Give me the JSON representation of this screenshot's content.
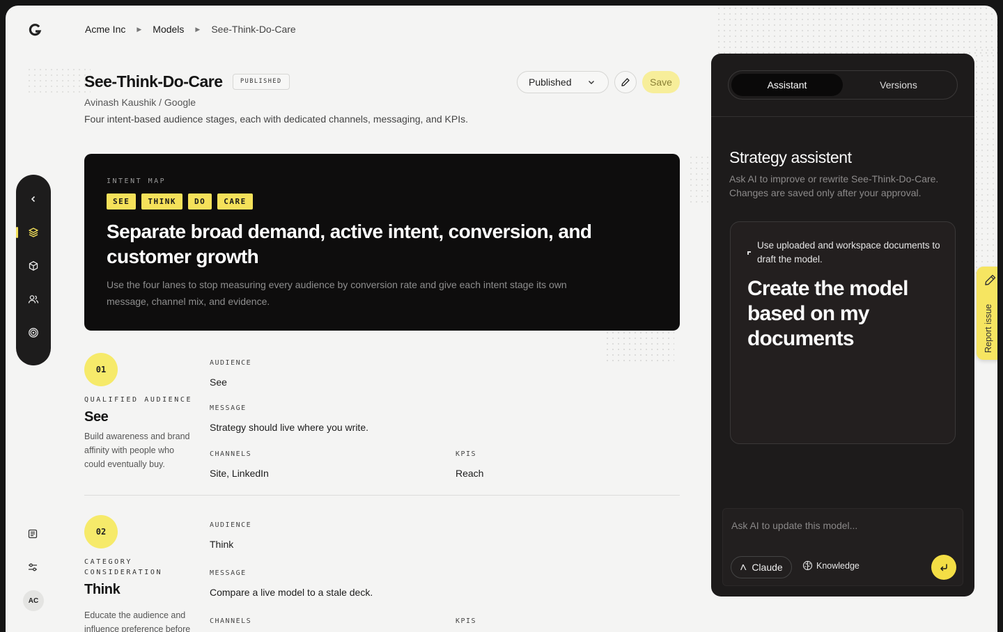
{
  "breadcrumbs": [
    "Acme Inc",
    "Models",
    "See-Think-Do-Care"
  ],
  "header": {
    "title": "See-Think-Do-Care",
    "badge": "PUBLISHED",
    "author": "Avinash Kaushik / Google",
    "description": "Four intent-based audience stages, each with dedicated channels, messaging, and KPIs.",
    "status_value": "Published",
    "save_label": "Save"
  },
  "intent_map": {
    "eyebrow": "INTENT MAP",
    "tags": [
      "SEE",
      "THINK",
      "DO",
      "CARE"
    ],
    "headline": "Separate broad demand, active intent, conversion, and customer growth",
    "body": "Use the four lanes to stop measuring every audience by conversion rate and give each intent stage its own message, channel mix, and evidence."
  },
  "field_labels": {
    "audience": "AUDIENCE",
    "message": "MESSAGE",
    "channels": "CHANNELS",
    "kpis": "KPIS"
  },
  "stages": [
    {
      "number": "01",
      "label": "QUALIFIED AUDIENCE",
      "name": "See",
      "description": "Build awareness and brand affinity with people who could eventually buy.",
      "audience": "See",
      "message": "Strategy should live where you write.",
      "channels": "Site, LinkedIn",
      "kpis": "Reach"
    },
    {
      "number": "02",
      "label": "CATEGORY CONSIDERATION",
      "name": "Think",
      "description": "Educate the audience and influence preference before",
      "audience": "Think",
      "message": "Compare a live model to a stale deck."
    }
  ],
  "panel": {
    "tabs": [
      "Assistant",
      "Versions"
    ],
    "title": "Strategy assistent",
    "subtitle": "Ask AI to improve or rewrite See-Think-Do-Care. Changes are saved only after your approval.",
    "card_hint": "Use uploaded and workspace documents to draft the model.",
    "card_headline": "Create the model based on my documents",
    "input_placeholder": "Ask AI to update this model...",
    "model_label": "Claude",
    "knowledge_label": "Knowledge"
  },
  "report_label": "Report issue",
  "user_initials": "AC",
  "colors": {
    "accent_yellow": "#f5e15a",
    "dark_card": "#0e0d0d",
    "panel_bg": "#1d1b1b",
    "page_bg": "#f4f4f3"
  }
}
